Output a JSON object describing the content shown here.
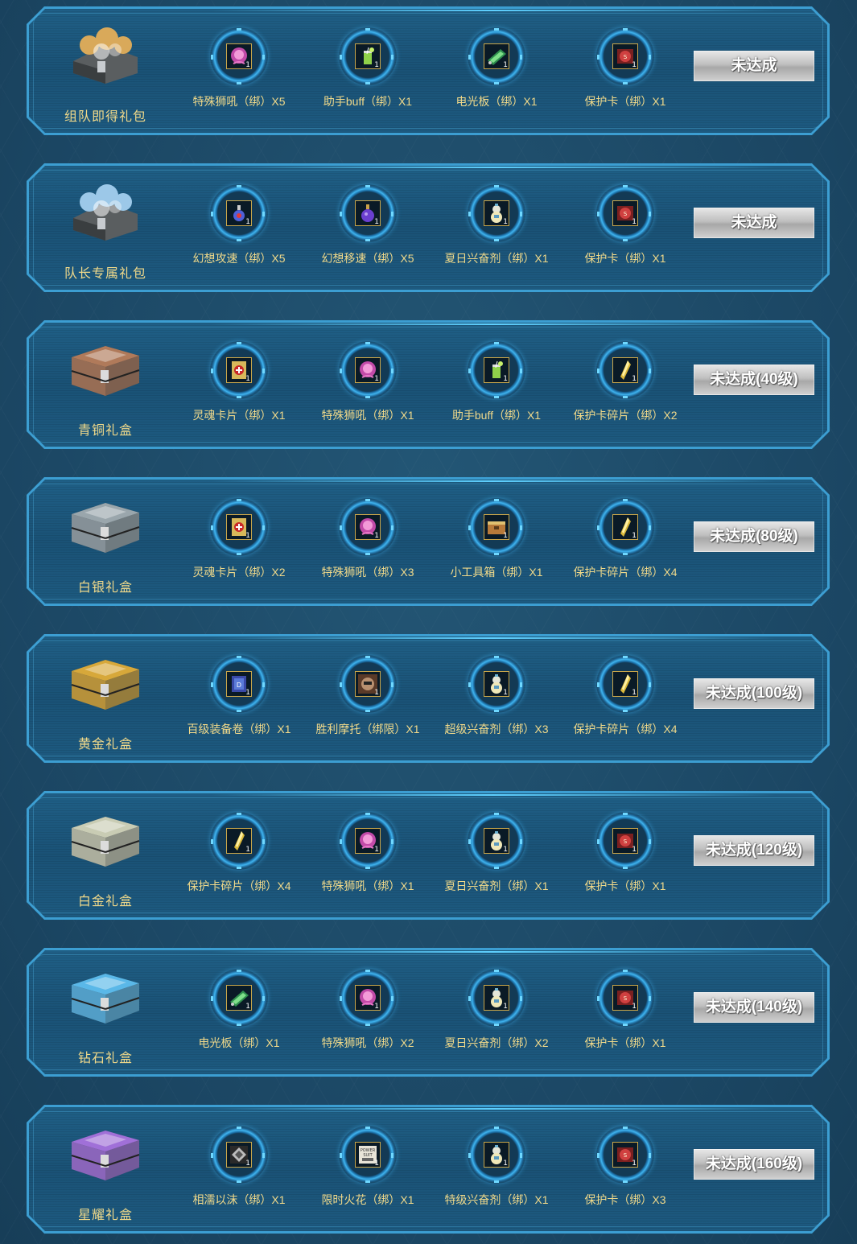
{
  "colors": {
    "background": "#1e4c6a",
    "frame_border": "#3c9ed2",
    "label_gold": "#f0d98a",
    "status_gray": "#bfbfbf"
  },
  "rows": [
    {
      "gift": {
        "label": "组队即得礼包",
        "icon": "crystal-gift-pile-gold",
        "color": "#d9a95a"
      },
      "items": [
        {
          "label": "特殊狮吼（绑）X5",
          "icon": "pink-lion-orb-icon",
          "qty": "1"
        },
        {
          "label": "助手buff（绑）X1",
          "icon": "green-drink-icon",
          "qty": "1"
        },
        {
          "label": "电光板（绑）X1",
          "icon": "electric-board-icon",
          "qty": "1"
        },
        {
          "label": "保护卡（绑）X1",
          "icon": "protect-card-icon",
          "qty": "1"
        }
      ],
      "status": "未达成"
    },
    {
      "gift": {
        "label": "队长专属礼包",
        "icon": "crystal-gift-pile-blue",
        "color": "#9cc8e8"
      },
      "items": [
        {
          "label": "幻想攻速（绑）X5",
          "icon": "red-potion-icon",
          "qty": "1"
        },
        {
          "label": "幻想移速（绑）X5",
          "icon": "purple-potion-icon",
          "qty": "1"
        },
        {
          "label": "夏日兴奋剂（绑）X1",
          "icon": "gourd-bottle-icon",
          "qty": "1"
        },
        {
          "label": "保护卡（绑）X1",
          "icon": "protect-card-icon",
          "qty": "1"
        }
      ],
      "status": "未达成"
    },
    {
      "gift": {
        "label": "青铜礼盒",
        "icon": "bronze-chest",
        "color": "#b07a5a"
      },
      "items": [
        {
          "label": "灵魂卡片（绑）X1",
          "icon": "soul-card-icon",
          "qty": "1"
        },
        {
          "label": "特殊狮吼（绑）X1",
          "icon": "pink-lion-orb-icon",
          "qty": "1"
        },
        {
          "label": "助手buff（绑）X1",
          "icon": "green-drink-icon",
          "qty": "1"
        },
        {
          "label": "保护卡碎片（绑）X2",
          "icon": "protect-shard-icon",
          "qty": "1"
        }
      ],
      "status": "未达成(40级)"
    },
    {
      "gift": {
        "label": "白银礼盒",
        "icon": "silver-chest",
        "color": "#9aa6ac"
      },
      "items": [
        {
          "label": "灵魂卡片（绑）X2",
          "icon": "soul-card-icon",
          "qty": "1"
        },
        {
          "label": "特殊狮吼（绑）X3",
          "icon": "pink-lion-orb-icon",
          "qty": "1"
        },
        {
          "label": "小工具箱（绑）X1",
          "icon": "toolbox-icon",
          "qty": "1"
        },
        {
          "label": "保护卡碎片（绑）X4",
          "icon": "protect-shard-icon",
          "qty": "1"
        }
      ],
      "status": "未达成(80级)"
    },
    {
      "gift": {
        "label": "黄金礼盒",
        "icon": "gold-chest",
        "color": "#d7a83a"
      },
      "items": [
        {
          "label": "百级装备卷（绑）X1",
          "icon": "equip-scroll-icon",
          "qty": "1"
        },
        {
          "label": "胜利摩托（绑限）X1",
          "icon": "victory-moto-icon",
          "qty": "1"
        },
        {
          "label": "超级兴奋剂（绑）X3",
          "icon": "gourd-bottle-icon",
          "qty": "1"
        },
        {
          "label": "保护卡碎片（绑）X4",
          "icon": "protect-shard-icon",
          "qty": "1"
        }
      ],
      "status": "未达成(100级)"
    },
    {
      "gift": {
        "label": "白金礼盒",
        "icon": "platinum-chest",
        "color": "#c9ccb4"
      },
      "items": [
        {
          "label": "保护卡碎片（绑）X4",
          "icon": "protect-shard-icon",
          "qty": "1"
        },
        {
          "label": "特殊狮吼（绑）X1",
          "icon": "pink-lion-orb-icon",
          "qty": "1"
        },
        {
          "label": "夏日兴奋剂（绑）X1",
          "icon": "gourd-bottle-icon",
          "qty": "1"
        },
        {
          "label": "保护卡（绑）X1",
          "icon": "protect-card-icon",
          "qty": "1"
        }
      ],
      "status": "未达成(120级)"
    },
    {
      "gift": {
        "label": "钻石礼盒",
        "icon": "diamond-chest",
        "color": "#5ab8e8"
      },
      "items": [
        {
          "label": "电光板（绑）X1",
          "icon": "electric-board-icon",
          "qty": "1"
        },
        {
          "label": "特殊狮吼（绑）X2",
          "icon": "pink-lion-orb-icon",
          "qty": "1"
        },
        {
          "label": "夏日兴奋剂（绑）X2",
          "icon": "gourd-bottle-icon",
          "qty": "1"
        },
        {
          "label": "保护卡（绑）X1",
          "icon": "protect-card-icon",
          "qty": "1"
        }
      ],
      "status": "未达成(140级)"
    },
    {
      "gift": {
        "label": "星耀礼盒",
        "icon": "star-chest",
        "color": "#a070d8"
      },
      "items": [
        {
          "label": "相濡以沫（绑）X1",
          "icon": "emblem-card-icon",
          "qty": "1"
        },
        {
          "label": "限时火花（绑）X1",
          "icon": "power-suit-icon",
          "qty": "1"
        },
        {
          "label": "特级兴奋剂（绑）X1",
          "icon": "gourd-bottle-icon",
          "qty": "1"
        },
        {
          "label": "保护卡（绑）X3",
          "icon": "protect-card-icon",
          "qty": "1"
        }
      ],
      "status": "未达成(160级)"
    }
  ]
}
